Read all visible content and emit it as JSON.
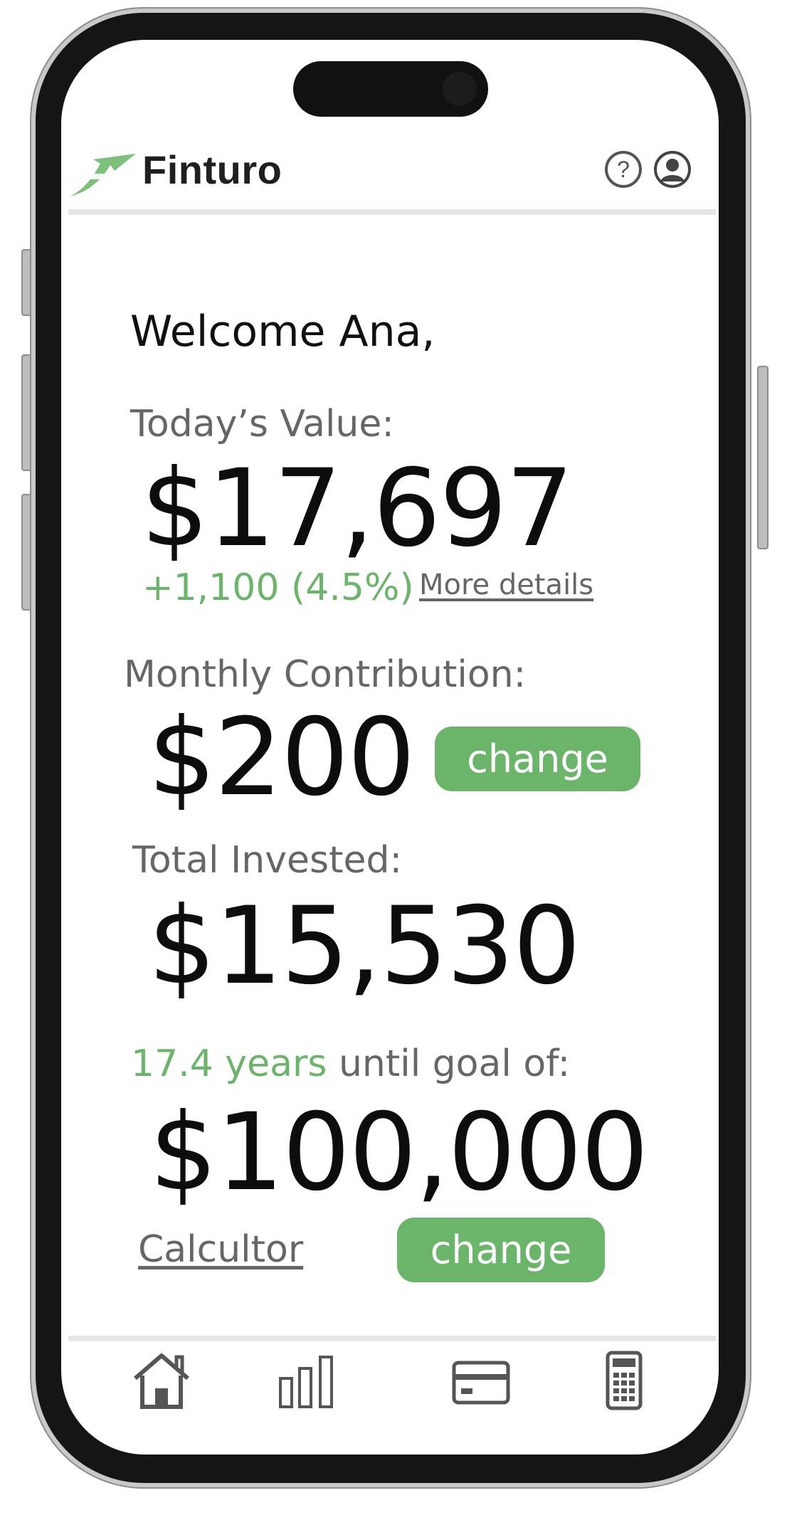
{
  "app": {
    "brand": "Finturo",
    "colors": {
      "accent": "#6bb56b",
      "text": "#0d0d0d",
      "muted": "#666666"
    }
  },
  "header": {
    "logo_icon": "finturo-arrow-logo",
    "help_icon": "question-circle-icon",
    "profile_icon": "user-circle-icon"
  },
  "greeting": "Welcome Ana,",
  "todays_value": {
    "label": "Today’s Value:",
    "amount": "$17,697",
    "change": "+1,100 (4.5%)",
    "details_link": "More details"
  },
  "monthly_contribution": {
    "label": "Monthly Contribution:",
    "amount": "$200",
    "button": "change"
  },
  "total_invested": {
    "label": "Total Invested:",
    "amount": "$15,530"
  },
  "goal": {
    "years": "17.4 years",
    "label_rest": " until goal of:",
    "amount": "$100,000",
    "calculator_link": "Calcultor",
    "button": "change"
  },
  "bottom_nav": [
    {
      "icon": "home-icon"
    },
    {
      "icon": "bar-chart-icon"
    },
    {
      "icon": "credit-card-icon"
    },
    {
      "icon": "calculator-icon"
    }
  ]
}
